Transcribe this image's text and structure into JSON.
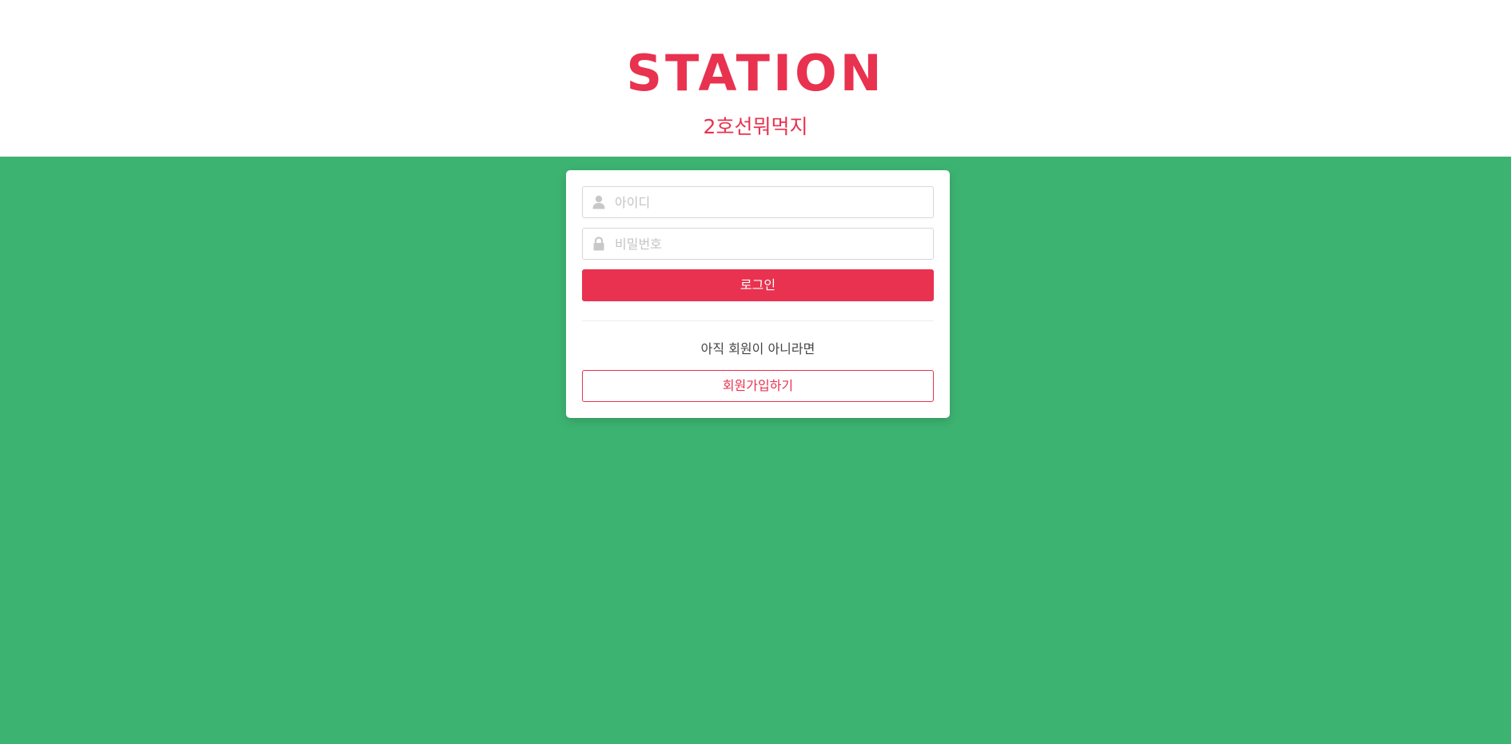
{
  "header": {
    "logo": "STATION",
    "subtitle": "2호선뭐먹지"
  },
  "login_form": {
    "id_field": {
      "placeholder": "아이디",
      "value": "",
      "icon": "user-icon"
    },
    "password_field": {
      "placeholder": "비밀번호",
      "value": "",
      "icon": "lock-icon"
    },
    "login_button_label": "로그인",
    "signup_prompt": "아직 회원이 아니라면",
    "signup_button_label": "회원가입하기"
  },
  "colors": {
    "brand": "#e8324f",
    "background": "#3db371",
    "header_background": "#ffffff"
  }
}
